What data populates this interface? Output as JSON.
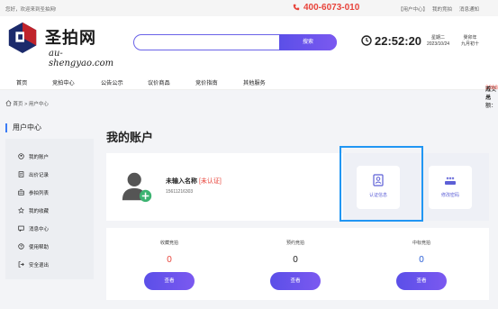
{
  "topbar": {
    "welcome": "您好，欢迎来到圣拍网!",
    "phone": "400-6073-010",
    "links": [
      "【用户中心】",
      "我的竞拍",
      "消息通知"
    ]
  },
  "logo": {
    "cn_text": "圣拍网",
    "en_text": "au-shengyao.com"
  },
  "search": {
    "placeholder": "",
    "button_label": "搜索"
  },
  "clock": {
    "time": "22:52:20",
    "weekday": "星期二",
    "date": "2023/10/24",
    "lunar_year": "癸卯年",
    "lunar_day": "九月初十"
  },
  "nav": {
    "items": [
      "首页",
      "竞拍中心",
      "公告公示",
      "议价商品",
      "竞价指南",
      "其他服务"
    ],
    "total_label": "成交总额：",
    "total_value": "3268900",
    "total_unit": " 万元"
  },
  "breadcrumb": {
    "home": "首页",
    "sep": ">",
    "current": "用户中心"
  },
  "sidebar": {
    "title": "用户中心",
    "items": [
      {
        "label": "我的账户",
        "icon": "account-icon"
      },
      {
        "label": "出价记录",
        "icon": "bid-record-icon"
      },
      {
        "label": "参拍列表",
        "icon": "auction-list-icon"
      },
      {
        "label": "我的收藏",
        "icon": "star-icon"
      },
      {
        "label": "消息中心",
        "icon": "message-icon"
      },
      {
        "label": "使用帮助",
        "icon": "help-icon"
      },
      {
        "label": "安全退出",
        "icon": "logout-icon"
      }
    ]
  },
  "account": {
    "title": "我的账户",
    "username": "未输入名称",
    "status_tag": "[未认证]",
    "phone": "15611216303",
    "quick_actions": [
      {
        "label": "认证信息",
        "icon": "id-card-icon"
      },
      {
        "label": "修改密码",
        "icon": "password-icon"
      }
    ]
  },
  "stats": [
    {
      "label": "收藏竞拍",
      "value": "0",
      "color": "#e8443b",
      "button": "查看"
    },
    {
      "label": "预约竞拍",
      "value": "0",
      "color": "#222222",
      "button": "查看"
    },
    {
      "label": "中标竞拍",
      "value": "0",
      "color": "#2a5fd6",
      "button": "查看"
    }
  ],
  "colors": {
    "accent": "#6a5cf0",
    "red": "#e8443b",
    "highlight": "#2196f3"
  }
}
